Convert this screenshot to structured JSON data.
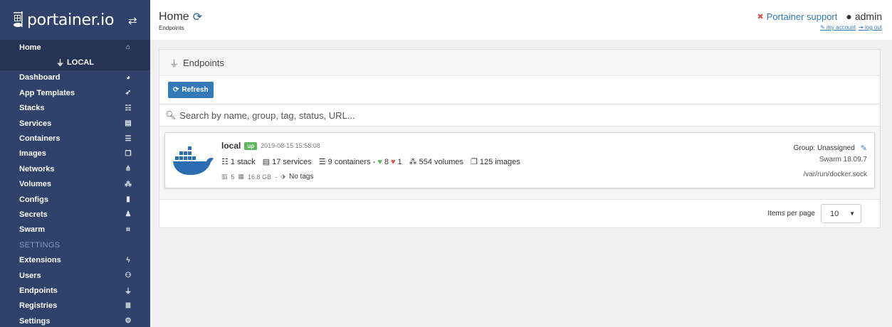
{
  "brand": {
    "name": "portainer.io"
  },
  "sidebar": {
    "home": "Home",
    "endpoint_label": "LOCAL",
    "items": [
      {
        "label": "Dashboard",
        "icon": "tachometer-icon"
      },
      {
        "label": "App Templates",
        "icon": "rocket-icon"
      },
      {
        "label": "Stacks",
        "icon": "th-list-icon"
      },
      {
        "label": "Services",
        "icon": "list-alt-icon"
      },
      {
        "label": "Containers",
        "icon": "server-icon"
      },
      {
        "label": "Images",
        "icon": "clone-icon"
      },
      {
        "label": "Networks",
        "icon": "sitemap-icon"
      },
      {
        "label": "Volumes",
        "icon": "cubes-icon"
      },
      {
        "label": "Configs",
        "icon": "file-code-icon"
      },
      {
        "label": "Secrets",
        "icon": "user-secret-icon"
      },
      {
        "label": "Swarm",
        "icon": "object-group-icon"
      }
    ],
    "settings_title": "SETTINGS",
    "settings_items": [
      {
        "label": "Extensions",
        "icon": "bolt-icon"
      },
      {
        "label": "Users",
        "icon": "users-icon"
      },
      {
        "label": "Endpoints",
        "icon": "plug-icon"
      },
      {
        "label": "Registries",
        "icon": "database-icon"
      },
      {
        "label": "Settings",
        "icon": "cogs-icon"
      }
    ]
  },
  "header": {
    "title": "Home",
    "breadcrumb": "Endpoints",
    "support": "Portainer support",
    "user": "admin",
    "my_account": "my account",
    "log_out": "log out"
  },
  "panel": {
    "title": "Endpoints",
    "refresh_label": "Refresh",
    "search_placeholder": "Search by name, group, tag, status, URL...",
    "items_per_page_label": "Items per page",
    "items_per_page_value": "10"
  },
  "endpoint": {
    "name": "local",
    "status": "up",
    "date": "2019-08-15 15:58:08",
    "stacks": "1 stack",
    "services": "17 services",
    "containers": "9 containers -",
    "healthy": "8",
    "unhealthy": "1",
    "volumes": "554 volumes",
    "images": "125 images",
    "cpu": "5",
    "memory": "16.8 GB",
    "sep": "-",
    "tags": "No tags",
    "group": "Group: Unassigned",
    "swarm": "Swarm 18.09.7",
    "url": "/var/run/docker.sock"
  },
  "colors": {
    "sidebar": "#30426a",
    "accent": "#337ab7",
    "success": "#5cb85c",
    "danger": "#d9534f"
  }
}
